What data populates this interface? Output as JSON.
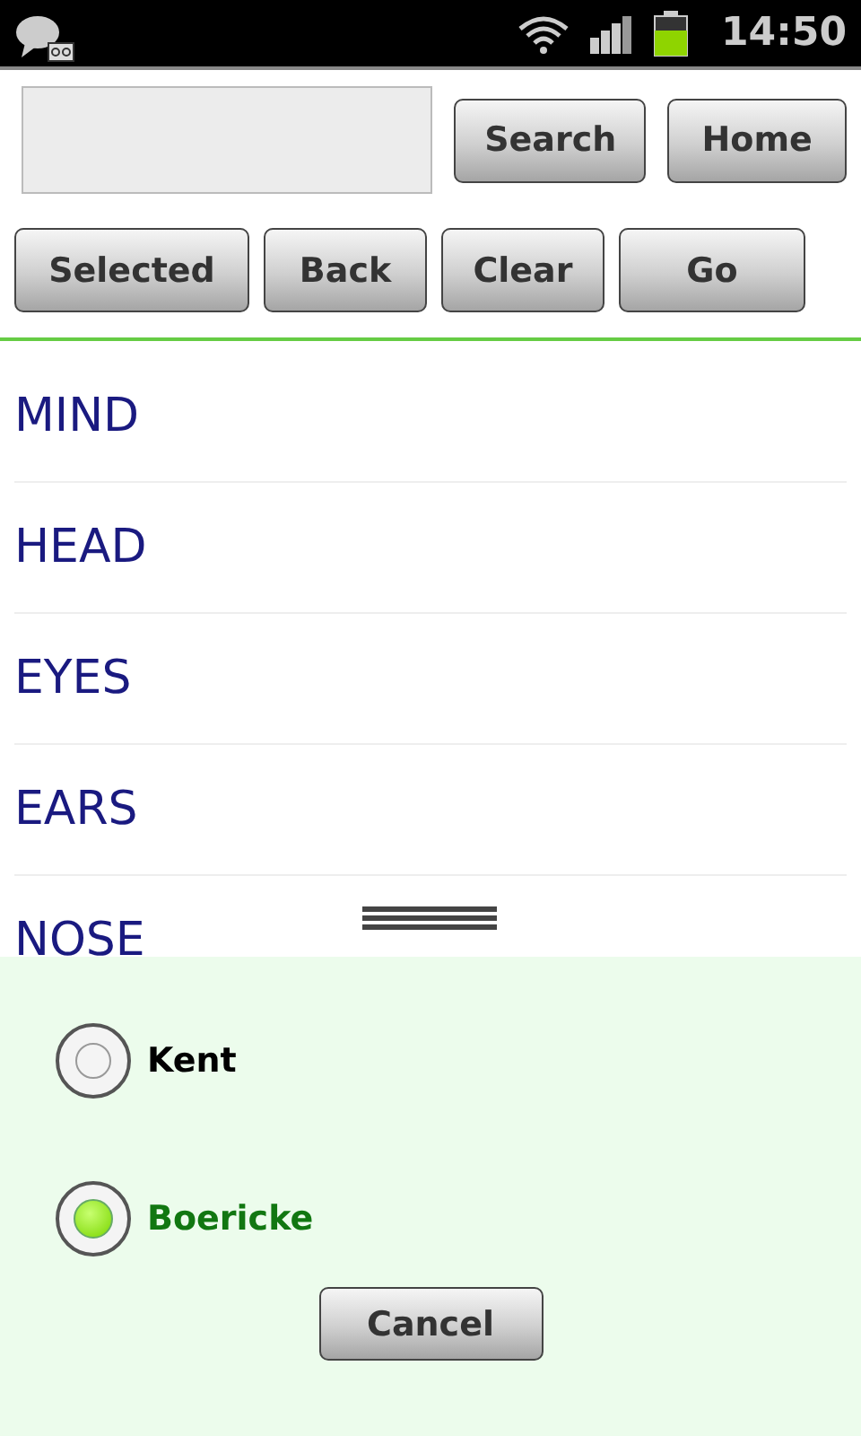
{
  "status_bar": {
    "time": "14:50"
  },
  "toolbar": {
    "buttons": [
      "Search",
      "Home"
    ]
  },
  "actions": [
    "Selected",
    "Back",
    "Clear",
    "Go"
  ],
  "list": {
    "items": [
      "MIND",
      "HEAD",
      "EYES",
      "EARS",
      "NOSE"
    ]
  },
  "sheet": {
    "options": [
      {
        "label": "Kent",
        "selected": false
      },
      {
        "label": "Boericke",
        "selected": true
      }
    ],
    "cancel": "Cancel"
  }
}
